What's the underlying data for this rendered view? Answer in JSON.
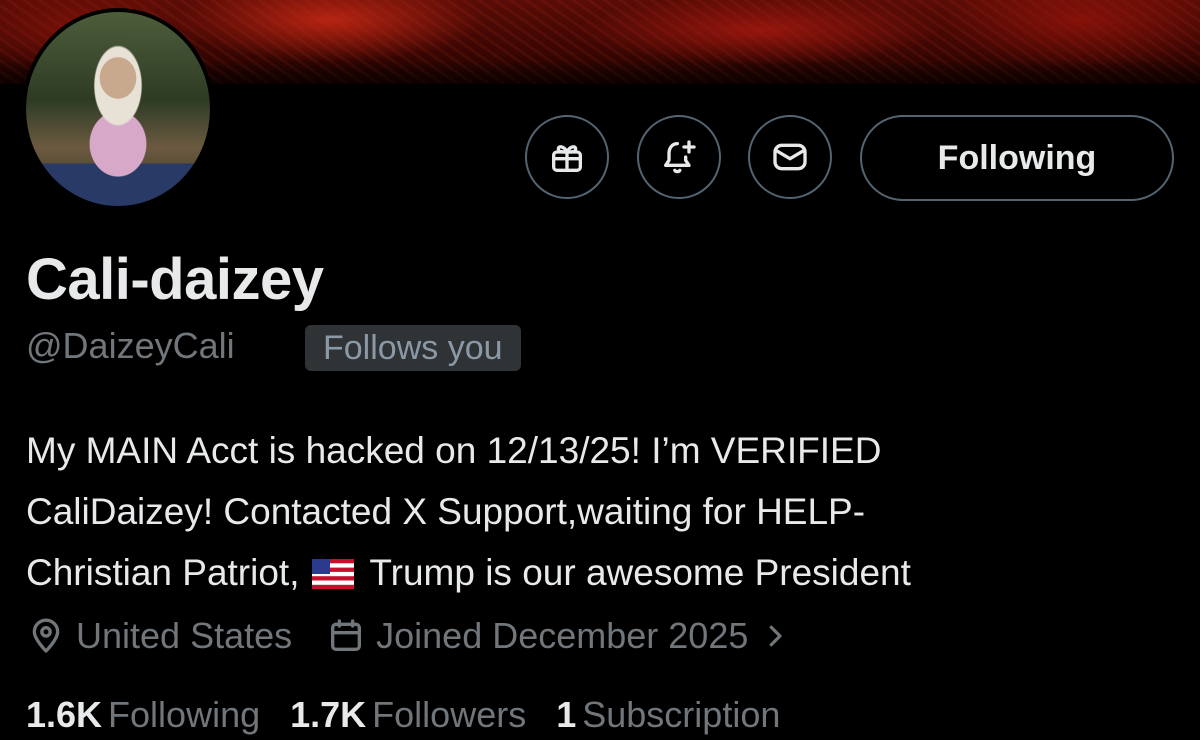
{
  "profile": {
    "display_name": "Cali-daizey",
    "handle": "@DaizeyCali",
    "follows_you_badge": "Follows you",
    "bio_line1": "My MAIN Acct is hacked on 12/13/25! I’m VERIFIED",
    "bio_line2": "CaliDaizey! Contacted X Support,waiting for HELP-",
    "bio_line3_before_flag": "Christian Patriot,",
    "bio_line3_after_flag": "Trump is our awesome President",
    "location": "United States",
    "joined": "Joined December 2025"
  },
  "actions": {
    "following_label": "Following",
    "icons": [
      "gift-icon",
      "notification-bell-plus-icon",
      "message-envelope-icon"
    ]
  },
  "stats": {
    "following_count": "1.6K",
    "following_label": "Following",
    "followers_count": "1.7K",
    "followers_label": "Followers",
    "subscriptions_count": "1",
    "subscriptions_label": "Subscription"
  },
  "colors": {
    "background": "#000000",
    "text_primary": "#e7e9ea",
    "text_secondary": "#71767b",
    "border": "#536471",
    "badge_bg": "#2f3336"
  }
}
